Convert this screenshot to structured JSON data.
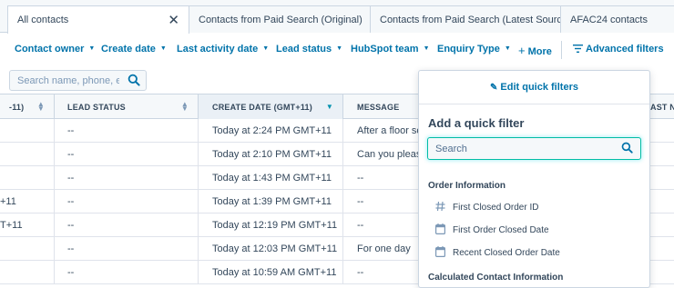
{
  "tabs": [
    {
      "label": "All contacts",
      "active": true
    },
    {
      "label": "Contacts from Paid Search (Original)",
      "active": false
    },
    {
      "label": "Contacts from Paid Search (Latest Source)",
      "active": false
    },
    {
      "label": "AFAC24 contacts",
      "active": false
    }
  ],
  "filters": {
    "contact_owner": "Contact owner",
    "create_date": "Create date",
    "last_activity_date": "Last activity date",
    "lead_status": "Lead status",
    "hubspot_team": "HubSpot team",
    "enquiry_type": "Enquiry Type",
    "more": "More",
    "advanced": "Advanced filters"
  },
  "search": {
    "placeholder": "Search name, phone, email"
  },
  "columns": {
    "first": "-11)",
    "lead_status": "LEAD STATUS",
    "create_date": "CREATE DATE (GMT+11)",
    "message": "MESSAGE",
    "last": "AST NP"
  },
  "rows": [
    {
      "col1": "",
      "lead_status": "--",
      "create_date": "Today at 2:24 PM GMT+11",
      "message": "After a floor scr"
    },
    {
      "col1": "",
      "lead_status": "--",
      "create_date": "Today at 2:10 PM GMT+11",
      "message": "Can you please"
    },
    {
      "col1": "",
      "lead_status": "--",
      "create_date": "Today at 1:43 PM GMT+11",
      "message": "--"
    },
    {
      "col1": "+11",
      "lead_status": "--",
      "create_date": "Today at 1:39 PM GMT+11",
      "message": "--"
    },
    {
      "col1": "T+11",
      "lead_status": "--",
      "create_date": "Today at 12:19 PM GMT+11",
      "message": "--"
    },
    {
      "col1": "",
      "lead_status": "--",
      "create_date": "Today at 12:03 PM GMT+11",
      "message": "For one day"
    },
    {
      "col1": "",
      "lead_status": "--",
      "create_date": "Today at 10:59 AM GMT+11",
      "message": "--"
    }
  ],
  "quick_filter": {
    "edit_label": "Edit quick filters",
    "title": "Add a quick filter",
    "search_placeholder": "Search",
    "group1": "Order Information",
    "options": [
      {
        "label": "First Closed Order ID",
        "icon": "hash-icon"
      },
      {
        "label": "First Order Closed Date",
        "icon": "calendar-icon"
      },
      {
        "label": "Recent Closed Order Date",
        "icon": "calendar-icon"
      }
    ],
    "group2": "Calculated Contact Information"
  },
  "colors": {
    "link": "#0073aa",
    "text": "#33475b",
    "focus": "#00bda5"
  }
}
